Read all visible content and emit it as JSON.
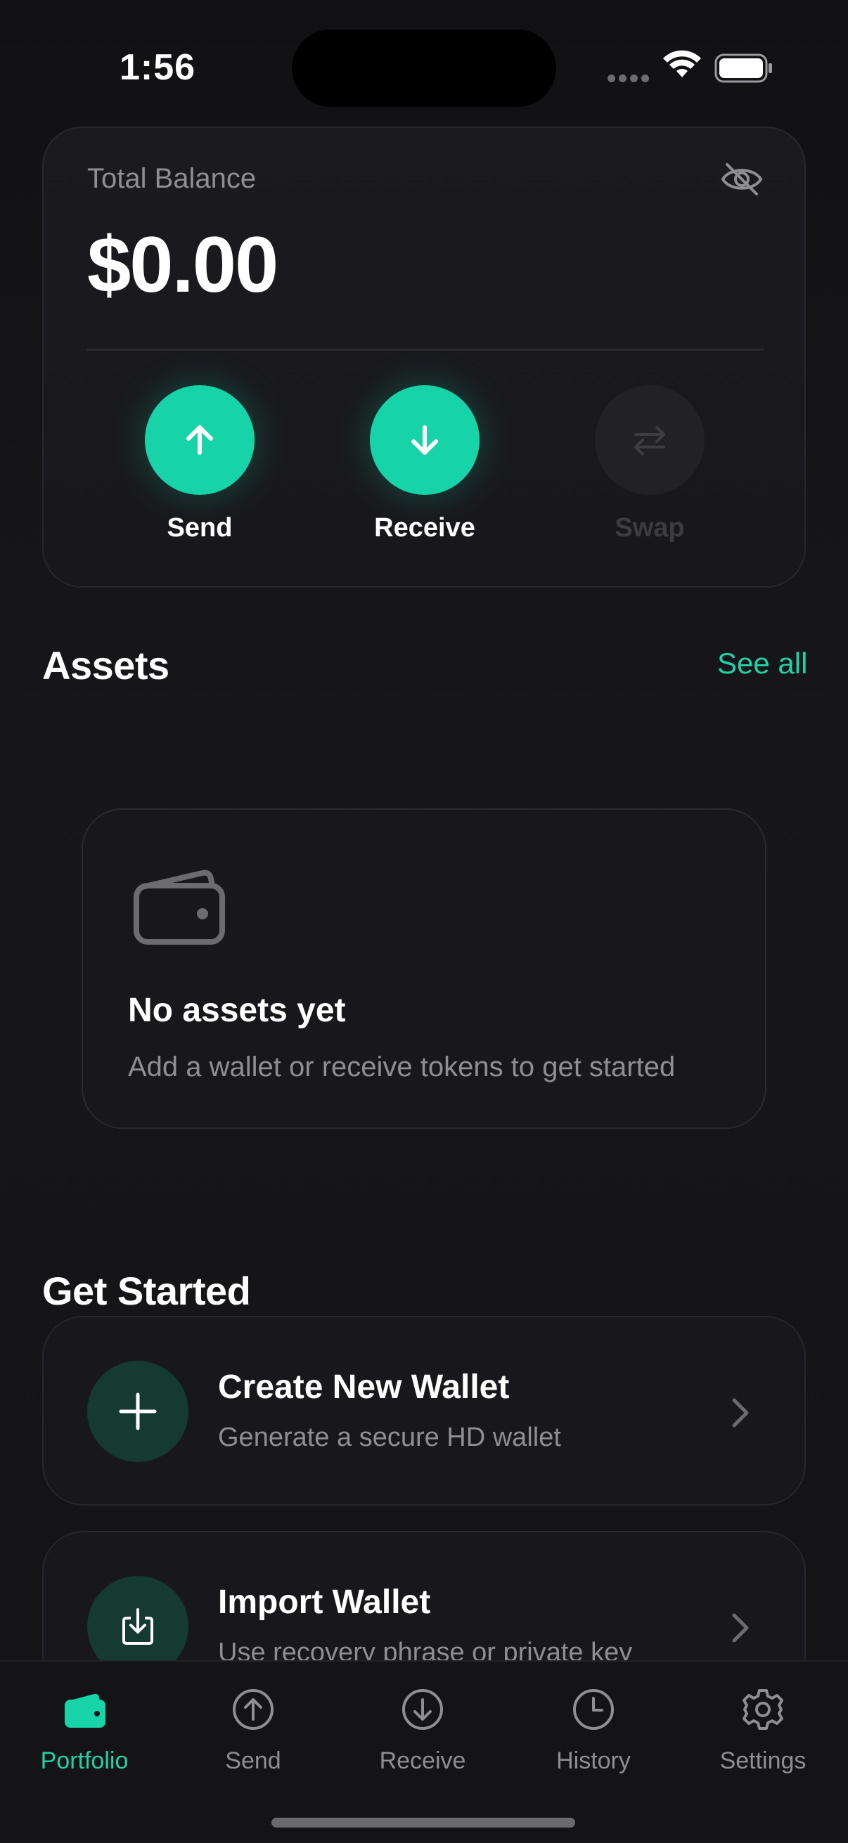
{
  "status_bar": {
    "time": "1:56"
  },
  "balance": {
    "label": "Total Balance",
    "value": "$0.00",
    "actions": [
      {
        "label": "Send",
        "icon": "arrow-up-icon",
        "enabled": true
      },
      {
        "label": "Receive",
        "icon": "arrow-down-icon",
        "enabled": true
      },
      {
        "label": "Swap",
        "icon": "swap-icon",
        "enabled": false
      }
    ]
  },
  "assets": {
    "title": "Assets",
    "see_all": "See all",
    "empty_title": "No assets yet",
    "empty_subtitle": "Add a wallet or receive tokens to get started"
  },
  "get_started": {
    "title": "Get Started",
    "items": [
      {
        "title": "Create New Wallet",
        "subtitle": "Generate a secure HD wallet",
        "icon": "plus-icon"
      },
      {
        "title": "Import Wallet",
        "subtitle": "Use recovery phrase or private key",
        "icon": "import-icon"
      }
    ]
  },
  "tab_bar": {
    "tabs": [
      {
        "label": "Portfolio",
        "icon": "wallet-icon",
        "active": true
      },
      {
        "label": "Send",
        "icon": "arrow-up-circle-icon",
        "active": false
      },
      {
        "label": "Receive",
        "icon": "arrow-down-circle-icon",
        "active": false
      },
      {
        "label": "History",
        "icon": "clock-icon",
        "active": false
      },
      {
        "label": "Settings",
        "icon": "gear-icon",
        "active": false
      }
    ]
  },
  "colors": {
    "accent": "#17d4a8",
    "background": "#121215",
    "card": "#18181c",
    "muted_text": "#8e8e93"
  }
}
